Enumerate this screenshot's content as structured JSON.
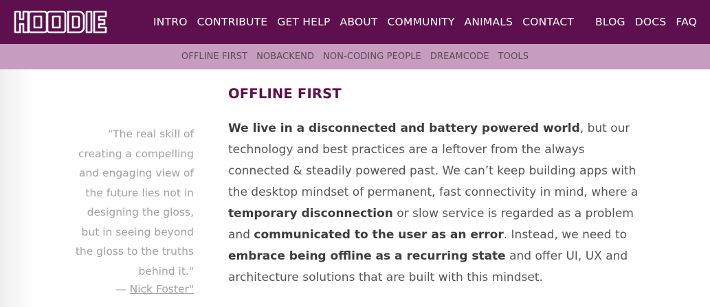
{
  "logo": {
    "text": "HOODIE"
  },
  "nav": {
    "main": [
      "INTRO",
      "CONTRIBUTE",
      "GET HELP",
      "ABOUT",
      "COMMUNITY",
      "ANIMALS",
      "CONTACT"
    ],
    "right": [
      "BLOG",
      "DOCS",
      "FAQ"
    ]
  },
  "subnav": [
    "OFFLINE FIRST",
    "NOBACKEND",
    "NON-CODING PEOPLE",
    "DREAMCODE",
    "TOOLS"
  ],
  "quote": {
    "lines": [
      "\"The real skill of",
      "creating a compelling",
      "and engaging view of",
      "the future lies not in",
      "designing the gloss,",
      "but in seeing beyond",
      "the gloss to the truths",
      "behind it.\""
    ],
    "dash": "— ",
    "author": "Nick Foster\""
  },
  "section": {
    "title": "OFFLINE FIRST",
    "p1_bold": "We live in a disconnected and battery powered world",
    "p1_a": ", but our technology and best practices are a leftover from the always connected & steadily powered past. We can’t keep building apps with the desktop mindset of permanent, fast connectivity in mind, where a ",
    "p1_bold2": "temporary disconnection",
    "p1_b": " or slow service is regarded as a problem and ",
    "p1_bold3": "communicated to the user as an error",
    "p1_c": ". Instead, we need to ",
    "p1_bold4": "embrace being offline as a recurring state",
    "p1_d": " and offer UI, UX and architecture solutions that are built with this mindset."
  },
  "colors": {
    "topbar": "#5e0f4d",
    "subbar": "#c79dbf",
    "title": "#5e0f4d"
  }
}
